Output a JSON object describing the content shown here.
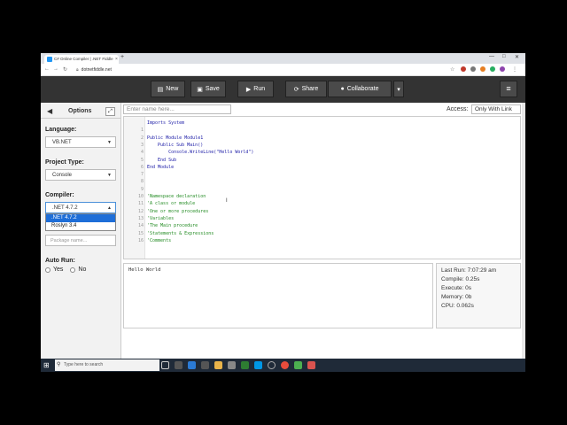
{
  "browser": {
    "tab_title": "C# Online Compiler | .NET Fiddle",
    "tab_close": "×",
    "new_tab": "+",
    "url": "dotnetfiddle.net",
    "window_buttons": [
      "—",
      "□",
      "✕"
    ]
  },
  "toolbar": {
    "new_label": "New",
    "save_label": "Save",
    "run_label": "Run",
    "share_label": "Share",
    "collaborate_label": "Collaborate",
    "more_label": "▾",
    "menu_label": "≡"
  },
  "sidebar": {
    "title": "Options",
    "language_label": "Language:",
    "language_value": "VB.NET",
    "project_type_label": "Project Type:",
    "project_type_value": "Console",
    "compiler_label": "Compiler:",
    "compiler_value": ".NET 4.7.2",
    "compiler_options": [
      ".NET 4.7.2",
      "Roslyn 3.4"
    ],
    "package_placeholder": "Package name...",
    "auto_run_label": "Auto Run:",
    "auto_run_yes": "Yes",
    "auto_run_no": "No"
  },
  "editor": {
    "name_placeholder": "Enter name here...",
    "access_label": "Access:",
    "access_value": "Only With Link",
    "code_lines": [
      {
        "n": "",
        "text": "Imports System",
        "type": "code"
      },
      {
        "n": "1",
        "text": "",
        "type": "code"
      },
      {
        "n": "2",
        "text": "Public Module Module1",
        "type": "code"
      },
      {
        "n": "3",
        "text": "    Public Sub Main()",
        "type": "code"
      },
      {
        "n": "4",
        "text": "        Console.WriteLine(\"Hello World\")",
        "type": "code"
      },
      {
        "n": "5",
        "text": "    End Sub",
        "type": "code"
      },
      {
        "n": "6",
        "text": "End Module",
        "type": "code"
      },
      {
        "n": "7",
        "text": "",
        "type": "code"
      },
      {
        "n": "8",
        "text": "",
        "type": "code"
      },
      {
        "n": "9",
        "text": "",
        "type": "code"
      },
      {
        "n": "10",
        "text": "'Namespace declaration",
        "type": "comment"
      },
      {
        "n": "11",
        "text": "'A class or module",
        "type": "comment"
      },
      {
        "n": "12",
        "text": "'One or more procedures",
        "type": "comment"
      },
      {
        "n": "13",
        "text": "'Variables",
        "type": "comment"
      },
      {
        "n": "14",
        "text": "'The Main procedure",
        "type": "comment"
      },
      {
        "n": "15",
        "text": "'Statements & Expressions",
        "type": "comment"
      },
      {
        "n": "16",
        "text": "'Comments",
        "type": "comment"
      }
    ]
  },
  "output": {
    "text": "Hello World"
  },
  "stats": {
    "last_run": "Last Run: 7:07:29 am",
    "compile": "Compile:  0.25s",
    "execute": "Execute:  0s",
    "memory": "Memory:   0b",
    "cpu": "CPU:      0.062s"
  },
  "taskbar": {
    "search_placeholder": "Type here to search",
    "icons": [
      "task-view-icon",
      "edge-icon",
      "store-icon",
      "explorer-icon",
      "mail-icon",
      "android-icon",
      "skype-icon",
      "clock-icon",
      "chrome-icon",
      "camtasia-icon",
      "recorder-icon"
    ]
  }
}
